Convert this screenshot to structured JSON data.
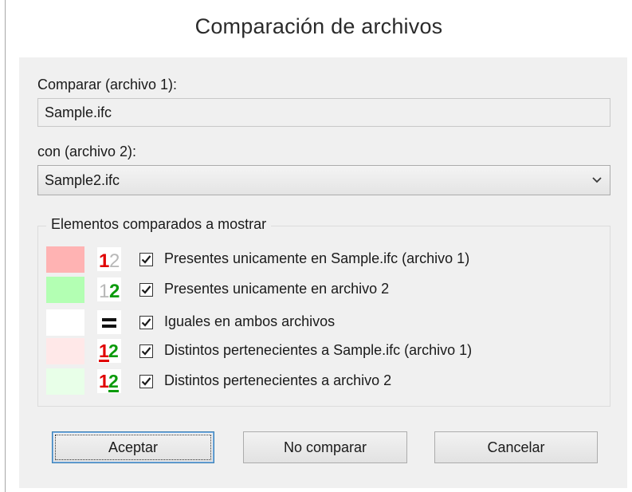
{
  "window": {
    "title": "Comparación de archivos"
  },
  "file1": {
    "label": "Comparar (archivo 1):",
    "value": "Sample.ifc"
  },
  "file2": {
    "label": "con (archivo 2):",
    "selected": "Sample2.ifc",
    "icon": "chevron-down-icon"
  },
  "group": {
    "legend": "Elementos comparados a mostrar",
    "rows": [
      {
        "label": "Presentes unicamente en Sample.ifc (archivo 1)",
        "checked": true,
        "swatch_color": "#ffb3b3",
        "icon": "only-in-file1-icon"
      },
      {
        "label": "Presentes unicamente en archivo 2",
        "checked": true,
        "swatch_color": "#b3ffb3",
        "icon": "only-in-file2-icon"
      },
      {
        "label": "Iguales en ambos archivos",
        "checked": true,
        "swatch_color": "#ffffff",
        "icon": "equals-icon"
      },
      {
        "label": "Distintos pertenecientes a Sample.ifc (archivo 1)",
        "checked": true,
        "swatch_color": "#ffe8e8",
        "icon": "different-file1-icon"
      },
      {
        "label": "Distintos pertenecientes a archivo 2",
        "checked": true,
        "swatch_color": "#e8ffe8",
        "icon": "different-file2-icon"
      }
    ]
  },
  "buttons": {
    "accept": "Aceptar",
    "no_compare": "No comparar",
    "cancel": "Cancelar"
  },
  "colors": {
    "red_digit": "#e00000",
    "green_digit": "#0a9a0a",
    "grey_digit": "#b8b8b8"
  }
}
